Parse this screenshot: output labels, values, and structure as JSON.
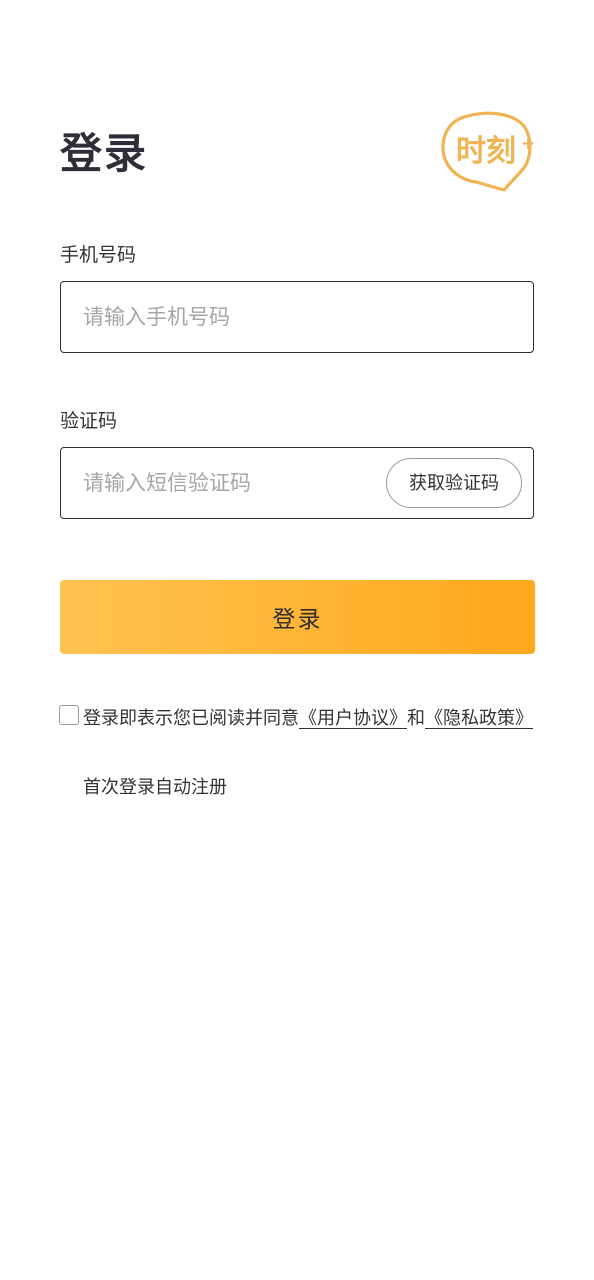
{
  "header": {
    "title": "登录",
    "logo_text": "时刻",
    "logo_plus": "+"
  },
  "phone": {
    "label": "手机号码",
    "placeholder": "请输入手机号码",
    "value": ""
  },
  "code": {
    "label": "验证码",
    "placeholder": "请输入短信验证码",
    "value": "",
    "get_code_label": "获取验证码"
  },
  "login_button": {
    "label": "登录"
  },
  "agreement": {
    "checked": false,
    "prefix": "登录即表示您已阅读并同意",
    "user_agreement": "《用户协议》",
    "conjunction": "和",
    "privacy_policy": "《隐私政策》",
    "auto_register": "首次登录自动注册"
  },
  "colors": {
    "accent_start": "#ffc251",
    "accent_end": "#ffa81c",
    "logo": "#f0b454",
    "text_primary": "#2e2e38"
  }
}
